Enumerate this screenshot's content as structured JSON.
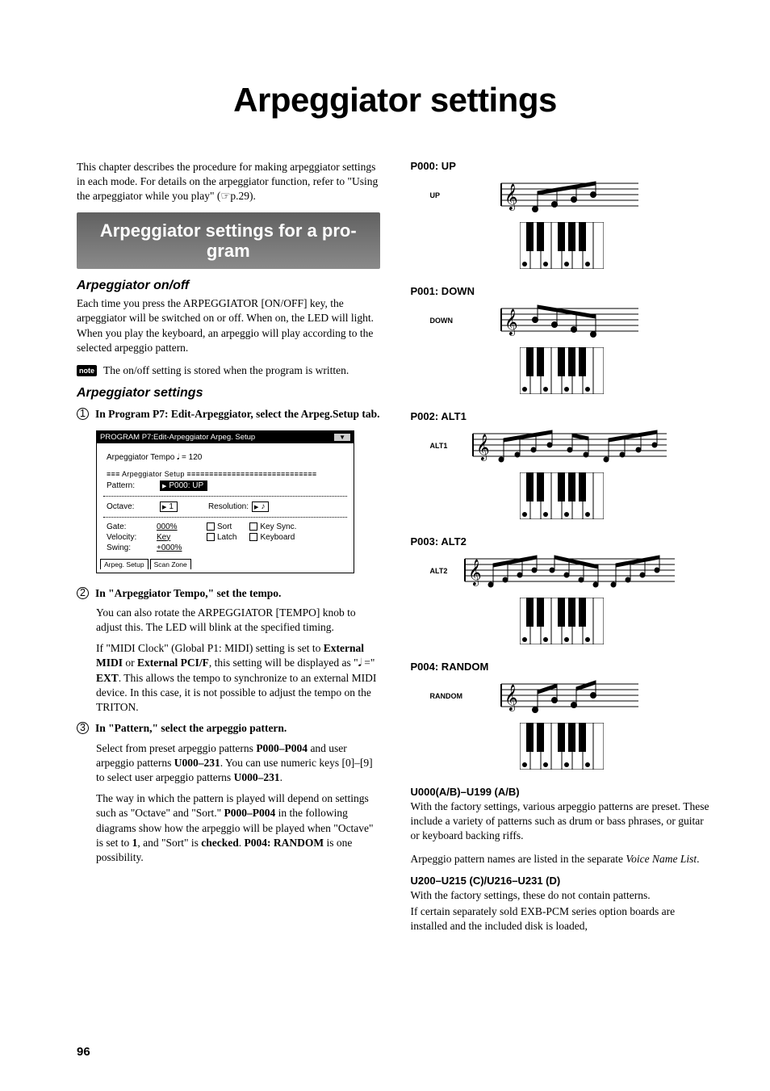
{
  "title": "Arpeggiator settings",
  "intro": "This chapter describes the procedure for making arpeggiator settings in each mode. For details on the arpeggiator function, refer to \"Using the arpeggiator while you play\" (☞p.29).",
  "banner": "Arpeggiator settings for a program",
  "h_onoff": "Arpeggiator on/off",
  "p_onoff": "Each time you press the ARPEGGIATOR [ON/OFF] key, the arpeggiator will be switched on or off. When on, the LED will light. When you play the keyboard, an arpeggio will play according to the selected arpeggio pattern.",
  "note_label": "note",
  "note_text": "The on/off setting is stored when the program is written.",
  "h_settings": "Arpeggiator settings",
  "steps": [
    {
      "n": "1",
      "text": "In Program P7: Edit-Arpeggiator, select the Arpeg.Setup tab."
    },
    {
      "n": "2",
      "text": "In \"Arpeggiator Tempo,\" set the tempo."
    },
    {
      "n": "3",
      "text": "In \"Pattern,\" select the arpeggio pattern."
    }
  ],
  "shot": {
    "title": "PROGRAM P7:Edit-Arpeggiator   Arpeg. Setup",
    "tempo_line": "Arpeggiator Tempo 𝅘𝅥 =  120",
    "section": "Arpeggiator  Setup",
    "rows": {
      "pattern_label": "Pattern:",
      "pattern_val": "P000: UP",
      "octave_label": "Octave:",
      "octave_val": "1",
      "reso_label": "Resolution:",
      "reso_val": "♪",
      "gate_label": "Gate:",
      "gate_val": "000%",
      "sort": "Sort",
      "keysync": "Key Sync.",
      "velocity_label": "Velocity:",
      "velocity_val": "Key",
      "latch": "Latch",
      "keyboard": "Keyboard",
      "swing_label": "Swing:",
      "swing_val": "+000%"
    },
    "tabs": [
      "Arpeg. Setup",
      "Scan Zone"
    ]
  },
  "after2_a": "You can also rotate the ARPEGGIATOR [TEMPO] knob to adjust this. The LED will blink at the specified timing.",
  "after2_b_pre": "If \"MIDI Clock\" (Global P1: MIDI) setting is set to ",
  "after2_b_bold1": "External MIDI",
  "after2_b_mid": " or ",
  "after2_b_bold2": "External PCI/F",
  "after2_b_post1": ", this setting will be displayed as \"𝅘𝅥 =\" ",
  "after2_b_bold3": "EXT",
  "after2_b_post2": ". This allows the tempo to synchronize to an external MIDI device. In this case, it is not possible to adjust the tempo on the TRITON.",
  "after3_a_pre": "Select from preset arpeggio patterns ",
  "after3_a_b1": "P000–P004",
  "after3_a_mid": " and user arpeggio patterns ",
  "after3_a_b2": "U000–231",
  "after3_a_post": ". You can use numeric keys [0]–[9] to select user arpeggio patterns ",
  "after3_a_b3": "U000–231",
  "after3_a_end": ".",
  "after3_b_pre": "The way in which the pattern is played will depend on settings such as \"Octave\" and \"Sort.\" ",
  "after3_b_b1": "P000–P004",
  "after3_b_mid": " in the following diagrams show how the arpeggio will be played when \"Octave\" is set to ",
  "after3_b_b2": "1",
  "after3_b_mid2": ", and \"Sort\" is ",
  "after3_b_b3": "checked",
  "after3_b_mid3": ". ",
  "after3_b_b4": "P004: RANDOM",
  "after3_b_end": " is one possibility.",
  "patterns": [
    {
      "title": "P000: UP",
      "label": "UP"
    },
    {
      "title": "P001: DOWN",
      "label": "DOWN"
    },
    {
      "title": "P002: ALT1",
      "label": "ALT1"
    },
    {
      "title": "P003: ALT2",
      "label": "ALT2"
    },
    {
      "title": "P004: RANDOM",
      "label": "RANDOM"
    }
  ],
  "u000_title": "U000(A/B)–U199 (A/B)",
  "u000_body": "With the factory settings, various arpeggio patterns are preset. These include a variety of patterns such as drum or bass phrases, or guitar or keyboard backing riffs.",
  "u000_body2": "Arpeggio pattern names are listed in the separate ",
  "u000_italic": "Voice Name List",
  "u000_body3": ".",
  "u200_title": "U200–U215 (C)/U216–U231 (D)",
  "u200_body": "With the factory settings, these do not contain patterns.",
  "u200_body2": "If certain separately sold EXB-PCM series option boards are installed and the included disk is loaded,",
  "pagenum": "96"
}
